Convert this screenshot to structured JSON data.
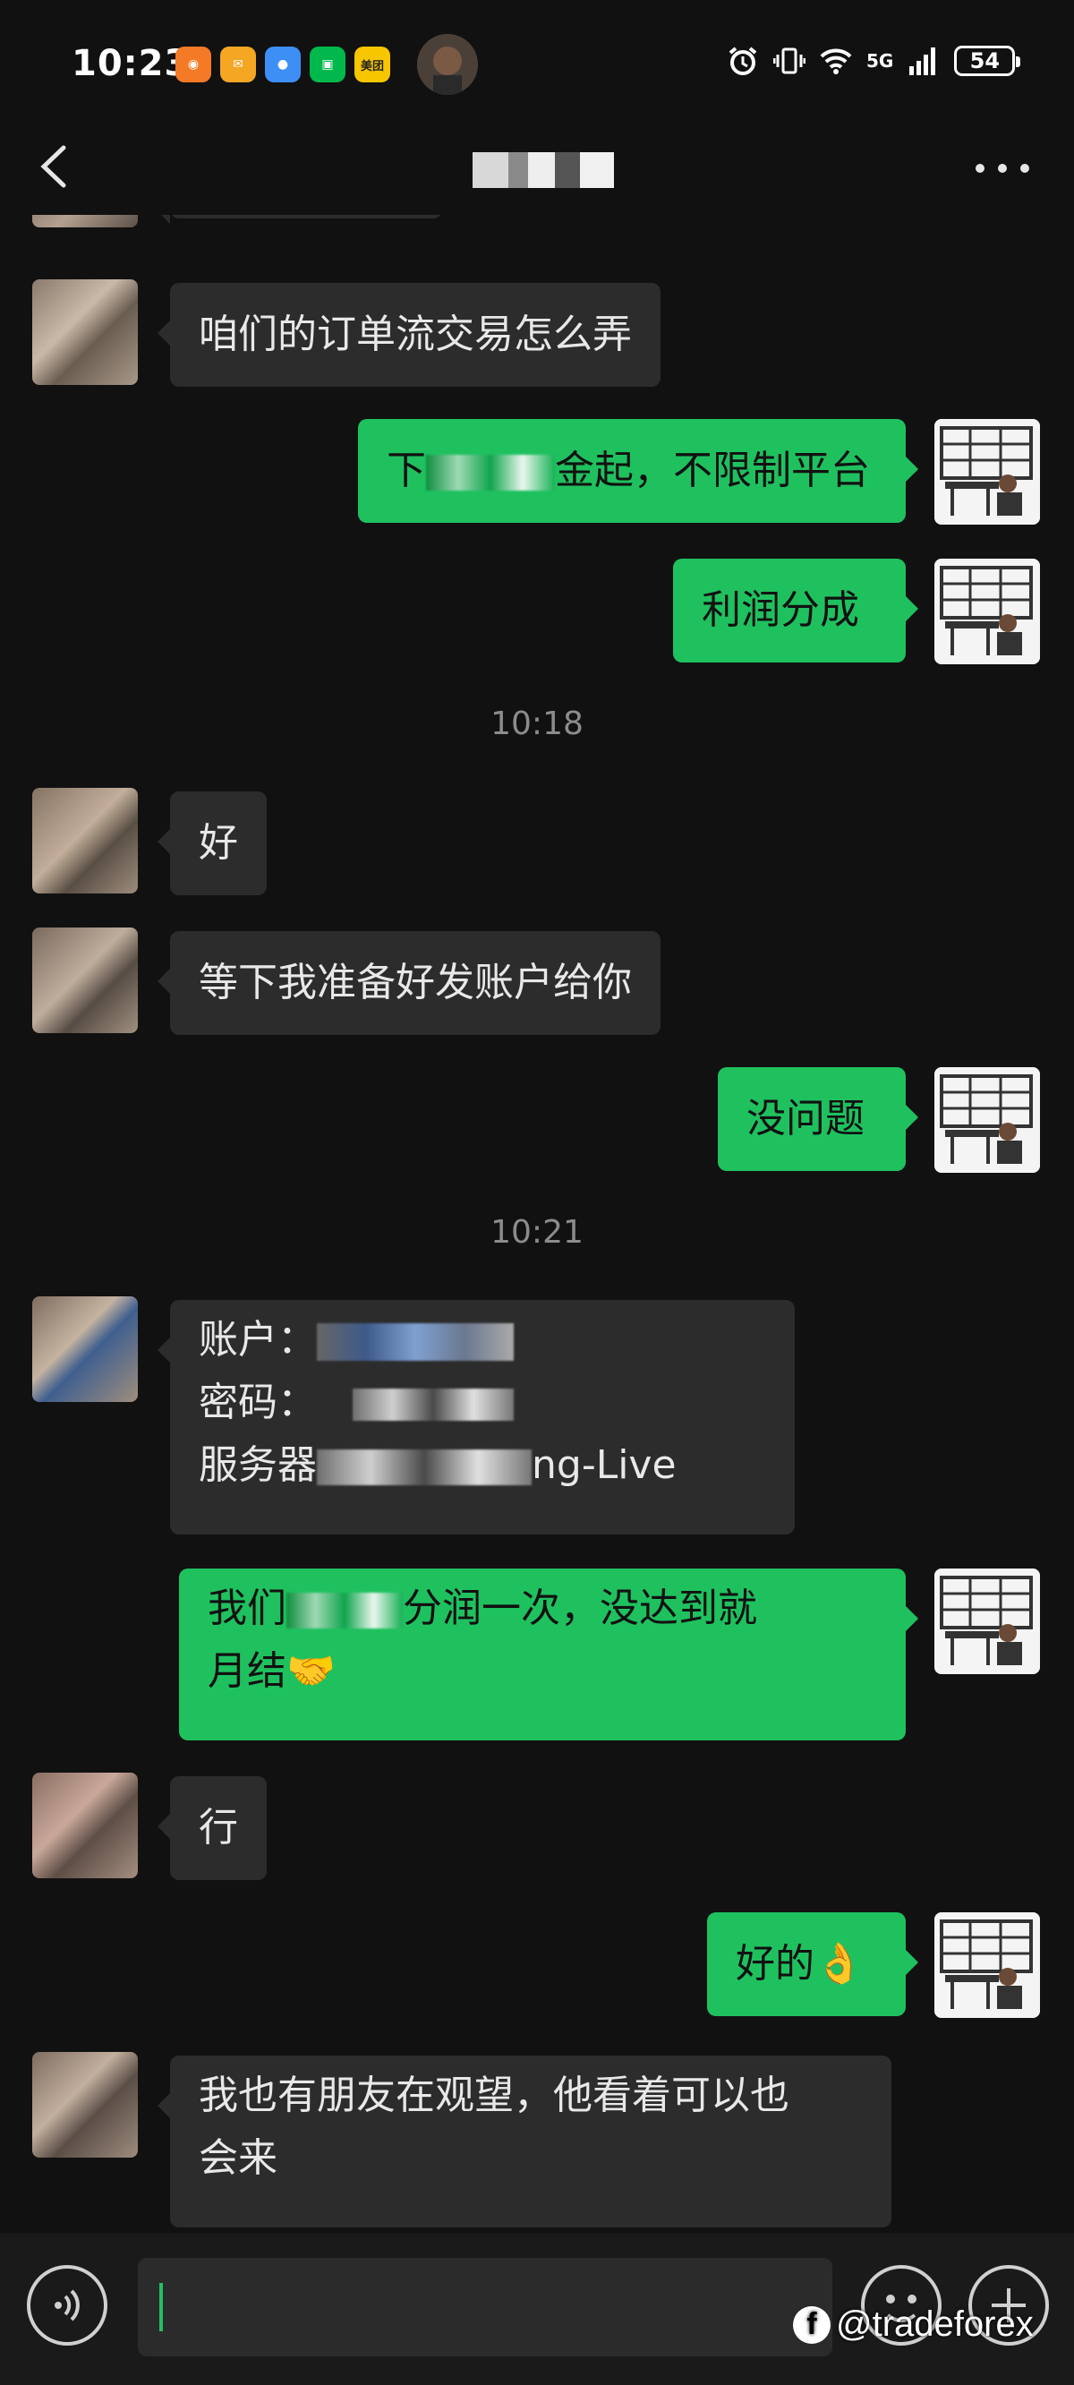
{
  "status_bar": {
    "time": "10:23",
    "app_icons": [
      {
        "name": "taobao-icon",
        "color": "#f47a25",
        "label": ""
      },
      {
        "name": "mail-icon",
        "color": "#f5a623",
        "label": ""
      },
      {
        "name": "message-icon",
        "color": "#3d8ff5",
        "label": ""
      },
      {
        "name": "iqiyi-icon",
        "color": "#00b84b",
        "label": ""
      },
      {
        "name": "meituan-icon",
        "color": "#f7c600",
        "label": "美团"
      }
    ],
    "network": "5G",
    "battery": "54"
  },
  "header": {
    "back_icon": "chevron-left-icon",
    "more_icon": "more-dots-icon"
  },
  "messages": {
    "m1": "咱们的订单流交易怎么弄",
    "m2a": "下",
    "m2b": "金起，不限制平台",
    "m3": "利润分成",
    "t1": "10:18",
    "m4": "好",
    "m5": "等下我准备好发账户给你",
    "m6": "没问题",
    "t2": "10:21",
    "m7_line1": "账户：",
    "m7_line2": "密码：",
    "m7_line3a": "服务器",
    "m7_line3b": "ng-Live",
    "m8a": "我们",
    "m8b": "分润一次，没达到就",
    "m8c": "月结",
    "m8_emoji": "🤝",
    "m9": "行",
    "m10": "好的",
    "m10_emoji": "👌",
    "m11_line1": "我也有朋友在观望，他看着可以也",
    "m11_line2": "会来"
  },
  "input_bar": {
    "text": "",
    "watermark": "@tradeforex",
    "watermark_logo": "f"
  }
}
